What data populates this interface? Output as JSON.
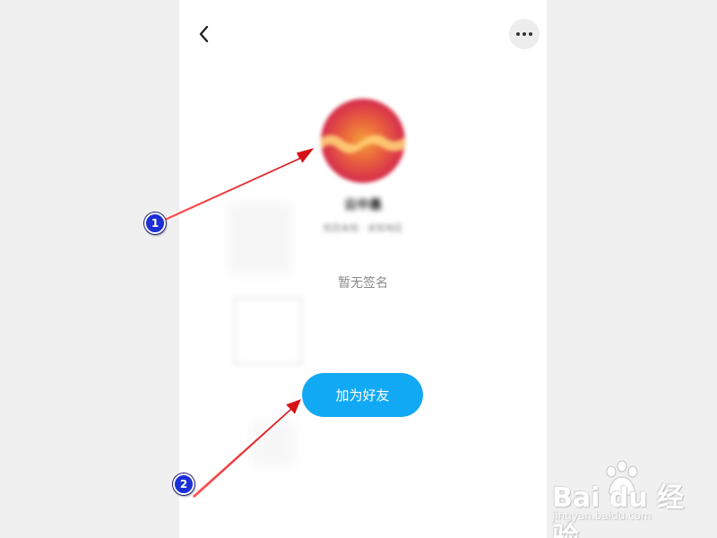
{
  "header": {
    "back_icon": "chevron-left-icon",
    "more_icon": "more-horizontal-icon"
  },
  "profile": {
    "nickname": "云中墨",
    "subinfo": "性别未知 · 未知地区",
    "signature": "暂无签名"
  },
  "actions": {
    "add_friend_label": "加为好友",
    "accent_color": "#12a9f4"
  },
  "annotations": {
    "markers": [
      "1",
      "2"
    ],
    "arrow_color": "#e8141a",
    "marker_color": "#1c2fd6"
  },
  "watermark": {
    "logo": "Bai du 经验",
    "url": "jingyan.baidu.com"
  }
}
